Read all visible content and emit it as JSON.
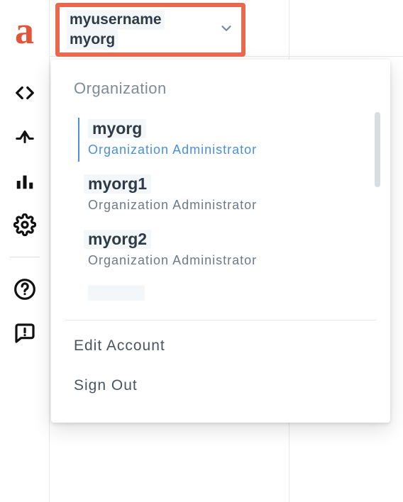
{
  "account": {
    "username": "myusername",
    "current_org": "myorg"
  },
  "dropdown": {
    "section_title": "Organization",
    "orgs": [
      {
        "name": "myorg",
        "role": "Organization Administrator",
        "selected": true
      },
      {
        "name": "myorg1",
        "role": "Organization Administrator",
        "selected": false
      },
      {
        "name": "myorg2",
        "role": "Organization Administrator",
        "selected": false
      }
    ],
    "actions": {
      "edit": "Edit Account",
      "signout": "Sign Out"
    }
  },
  "sidebar_icons": {
    "code": "code-icon",
    "upload": "upload-icon",
    "chart": "bar-chart-icon",
    "gear": "gear-icon",
    "help": "help-circle-icon",
    "feedback": "feedback-icon"
  }
}
